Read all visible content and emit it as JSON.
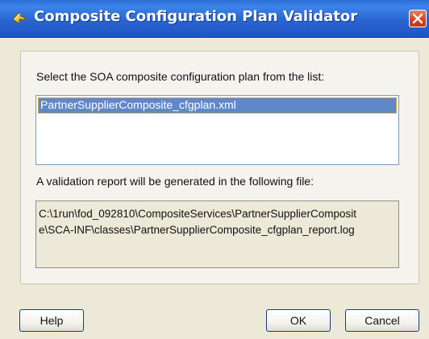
{
  "window": {
    "title": "Composite Configuration Plan Validator",
    "title_icon": "jdeveloper-arrow-icon",
    "close_icon": "close-icon"
  },
  "plan_section": {
    "prompt": "Select the SOA composite configuration plan from the list:",
    "items": [
      "PartnerSupplierComposite_cfgplan.xml"
    ],
    "selected_index": 0
  },
  "report_section": {
    "prompt": "A validation report will be generated in the following file:",
    "path_lines": [
      "C:\\1run\\fod_092810\\CompositeServices\\PartnerSupplierComposit",
      "e\\SCA-INF\\classes\\PartnerSupplierComposite_cfgplan_report.log"
    ]
  },
  "buttons": {
    "help": "Help",
    "ok": "OK",
    "cancel": "Cancel"
  },
  "colors": {
    "titlebar": "#2a64d1",
    "selection": "#5e88c6",
    "close": "#d6451e"
  }
}
